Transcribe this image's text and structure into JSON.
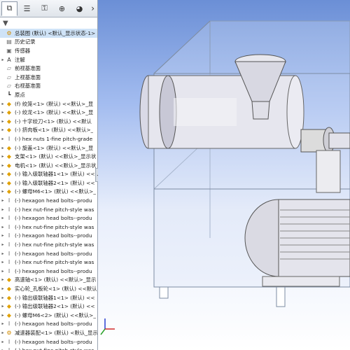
{
  "tabs": [
    {
      "name": "feature-manager",
      "icon": "⧉"
    },
    {
      "name": "property-manager",
      "icon": "☰"
    },
    {
      "name": "configuration-manager",
      "icon": "⚿"
    },
    {
      "name": "dimxpert",
      "icon": "⊕"
    },
    {
      "name": "display-manager",
      "icon": "◕"
    }
  ],
  "tab_more": "›",
  "filter_icon": "▼",
  "tree": [
    {
      "label": "总装图 (默认) <默认_显示状态-1>",
      "icon": "assembly",
      "root": true
    },
    {
      "label": "历史记录",
      "icon": "history"
    },
    {
      "label": "传感器",
      "icon": "sensor"
    },
    {
      "label": "注解",
      "icon": "annotation",
      "expand": "▸"
    },
    {
      "label": "前视基准面",
      "icon": "plane"
    },
    {
      "label": "上视基准面",
      "icon": "plane"
    },
    {
      "label": "右视基准面",
      "icon": "plane"
    },
    {
      "label": "原点",
      "icon": "origin"
    },
    {
      "label": "(f) 绞笼<1> (默认) <<默认>_显",
      "icon": "part",
      "expand": "▸"
    },
    {
      "label": "(-) 绞龙<1> (默认) <<默认>_显",
      "icon": "part",
      "expand": "▸"
    },
    {
      "label": "(-) 十字绞刀<1> (默认) <<默认",
      "icon": "part",
      "expand": "▸"
    },
    {
      "label": "(-) 挤肉板<1> (默认) <<默认>_",
      "icon": "part",
      "expand": "▸"
    },
    {
      "label": "(-) hex nuts 1-fine pitch-grade",
      "icon": "fastener",
      "expand": "▸"
    },
    {
      "label": "(-) 旋盖<1> (默认) <<默认>_显",
      "icon": "part",
      "expand": "▸"
    },
    {
      "label": "支架<1> (默认) <<默认>_显示状",
      "icon": "part",
      "expand": "▸"
    },
    {
      "label": "电机<1> (默认) <<默认>_显示状",
      "icon": "part",
      "expand": "▸"
    },
    {
      "label": "(-) 输入级联轴器1<1> (默认) <<",
      "icon": "part",
      "expand": "▸"
    },
    {
      "label": "(-) 输入级联轴器2<1> (默认) <<",
      "icon": "part",
      "expand": "▸"
    },
    {
      "label": "(-) 螺母M6<1> (默认) <<默认>_",
      "icon": "part",
      "expand": "▸"
    },
    {
      "label": "(-) hexagon head bolts--produ",
      "icon": "fastener",
      "expand": "▸"
    },
    {
      "label": "(-) hex nut-fine pitch-style was",
      "icon": "fastener",
      "expand": "▸"
    },
    {
      "label": "(-) hexagon head bolts--produ",
      "icon": "fastener",
      "expand": "▸"
    },
    {
      "label": "(-) hex nut-fine pitch-style was",
      "icon": "fastener",
      "expand": "▸"
    },
    {
      "label": "(-) hexagon head bolts--produ",
      "icon": "fastener",
      "expand": "▸"
    },
    {
      "label": "(-) hex nut-fine pitch-style was",
      "icon": "fastener",
      "expand": "▸"
    },
    {
      "label": "(-) hexagon head bolts--produ",
      "icon": "fastener",
      "expand": "▸"
    },
    {
      "label": "(-) hex nut-fine pitch-style was",
      "icon": "fastener",
      "expand": "▸"
    },
    {
      "label": "(-) hexagon head bolts--produ",
      "icon": "fastener",
      "expand": "▸"
    },
    {
      "label": "高速轴<1> (默认) <<默认>_显示",
      "icon": "part",
      "expand": "▸"
    },
    {
      "label": "实心轮_孔板轮<1> (默认) <<默认",
      "icon": "part",
      "expand": "▸"
    },
    {
      "label": "(-) 输出级联轴器1<1> (默认) <<",
      "icon": "part",
      "expand": "▸"
    },
    {
      "label": "(-) 输出级联轴器2<1> (默认) <<",
      "icon": "part",
      "expand": "▸"
    },
    {
      "label": "(-) 螺母M6<2> (默认) <<默认>_",
      "icon": "part",
      "expand": "▸"
    },
    {
      "label": "(-) hexagon head bolts--produ",
      "icon": "fastener",
      "expand": "▸"
    },
    {
      "label": "减速器装配<1> (默认) <默认_显示",
      "icon": "assembly",
      "expand": "▸"
    },
    {
      "label": "(-) hexagon head bolts--produ",
      "icon": "fastener",
      "expand": "▸"
    },
    {
      "label": "(-) hex nut-fine pitch-style was",
      "icon": "fastener",
      "expand": "▸"
    }
  ],
  "splitter_glyph": "◂",
  "colors": {
    "viewport_top": "#6b8fd6",
    "viewport_bottom": "#ffffff",
    "part_icon": "#e0a000",
    "fastener_icon": "#666666",
    "selection": "#cfe3f7"
  }
}
